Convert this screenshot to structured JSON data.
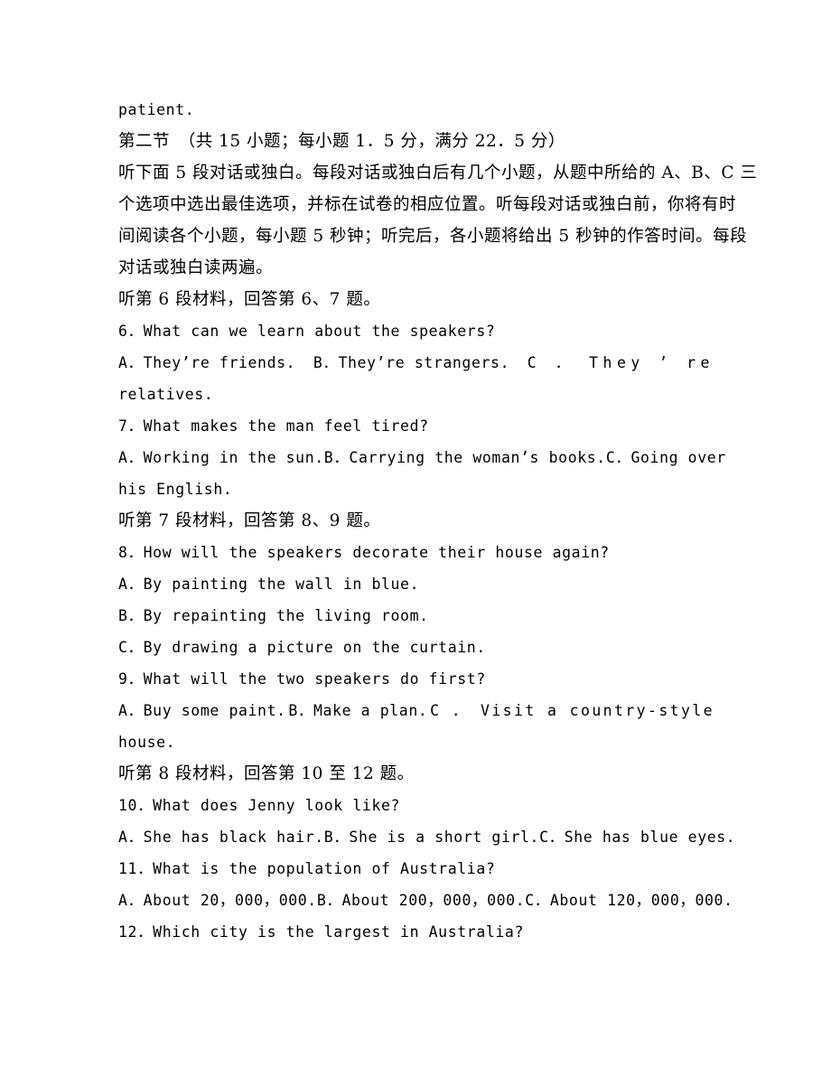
{
  "document": {
    "type": "exam-paper-page",
    "language": "zh-CN/en",
    "background_color": "#ffffff",
    "text_color": "#000000"
  },
  "lines": {
    "l01_patient": "patient.",
    "l02_section_head": "第二节　（共 15 小题；每小题 1．5 分，满分 22．5 分）",
    "l03_instr_a": "听下面 5 段对话或独白。每段对话或独白后有几个小题，从题中所给的 A、B、C 三",
    "l04_instr_b": "个选项中选出最佳选项，并标在试卷的相应位置。听每段对话或独白前，你将有时",
    "l05_instr_c": "间阅读各个小题，每小题 5 秒钟；听完后，各小题将给出 5 秒钟的作答时间。每段",
    "l06_instr_d": "对话或独白读两遍。",
    "l07_cue_6_7": "听第 6 段材料，回答第 6、7 题。",
    "l08_q6": "6．What can we learn about the speakers?",
    "l09_q6_opts_a": "A．They’re friends.",
    "l09_q6_opts_b": "B．They’re strangers.",
    "l09_q6_opts_c": "C ． They ’ re",
    "l10_q6_wrap": "relatives.",
    "l11_q7": "7．What makes the man feel tired?",
    "l12_q7_opts_a": "A．Working in the sun.",
    "l12_q7_opts_b": "B．Carrying the woman’s books.",
    "l12_q7_opts_c": "C．Going over",
    "l13_q7_wrap": "his English.",
    "l14_cue_8_9": "听第 7 段材料，回答第 8、9 题。",
    "l15_q8": "8．How will the speakers decorate their house again?",
    "l16_q8_a": "A．By painting the wall in blue.",
    "l17_q8_b": "B．By repainting the living room.",
    "l18_q8_c": "C．By drawing a picture on the curtain.",
    "l19_q9": "9．What will the two speakers do first?",
    "l20_q9_opts_a": "A．Buy some paint.",
    "l20_q9_opts_b": "B．Make a plan.",
    "l20_q9_opts_c": "C ． Visit a country-style",
    "l21_q9_wrap": "house.",
    "l22_cue_10_12": "听第 8 段材料，回答第 10 至 12 题。",
    "l23_q10": "10．What does Jenny look like?",
    "l24_q10_a": "A．She has black hair.",
    "l24_q10_b": "B．She is a short girl.",
    "l24_q10_c": "C．She has blue eyes.",
    "l25_q11": "11．What is the population of Australia?",
    "l26_q11_a": "A．About 20，000，000.",
    "l26_q11_b": "B．About 200，000，000.",
    "l26_q11_c": "C．About 120，000，000.",
    "l27_q12": "12．Which city is the largest in Australia?"
  },
  "parts": {
    "q6_c_prefix": "C ． They ",
    "q6_c_apos": "’",
    "q6_c_suffix": "re",
    "q9_c_1": "C ．",
    "q9_c_2": "Visit",
    "q9_c_3": "a",
    "q9_c_4": "country-style"
  }
}
